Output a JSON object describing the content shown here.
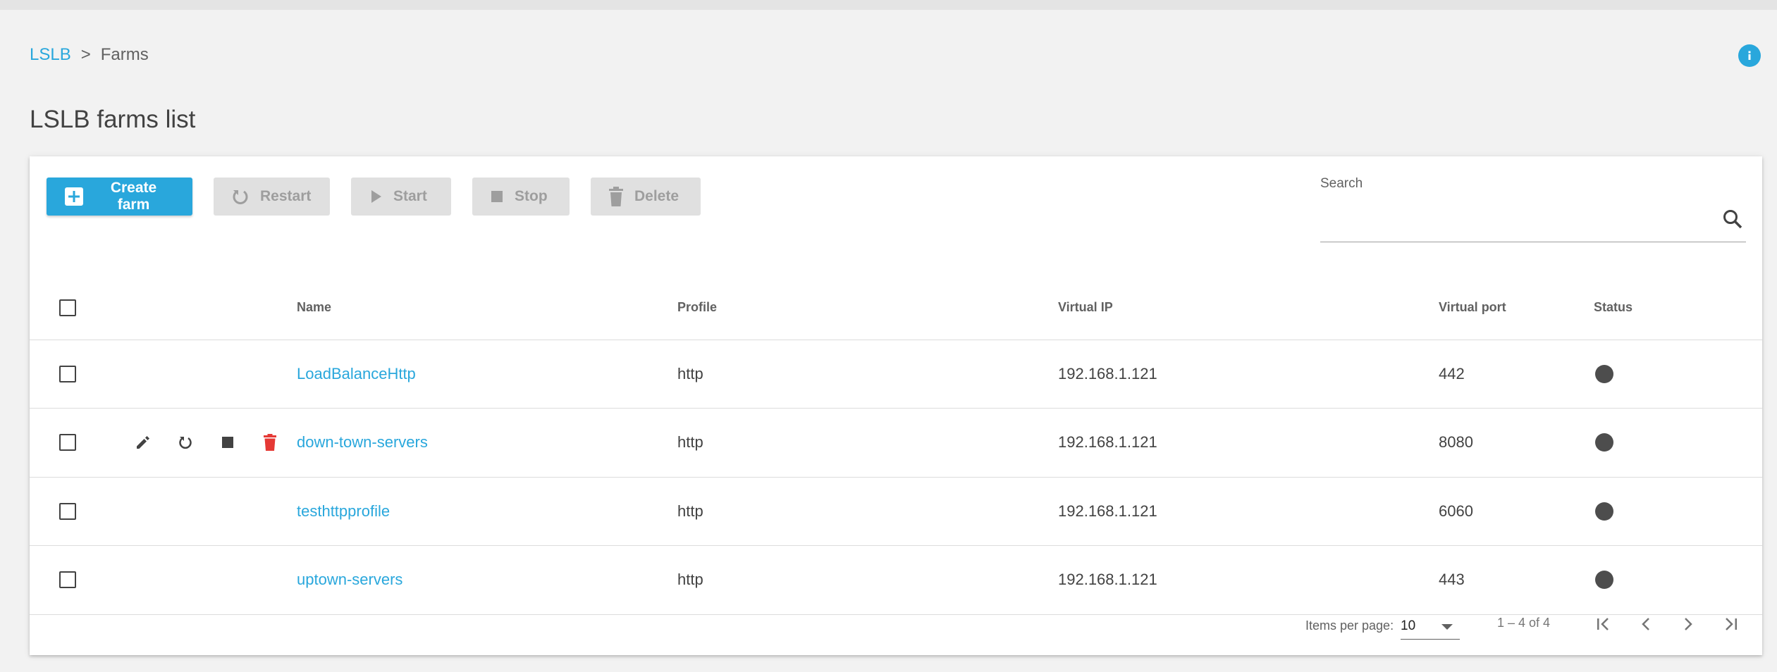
{
  "breadcrumb": {
    "root": "LSLB",
    "separator": ">",
    "current": "Farms"
  },
  "page": {
    "title": "LSLB farms list"
  },
  "toolbar": {
    "create_label": "Create farm",
    "restart_label": "Restart",
    "start_label": "Start",
    "stop_label": "Stop",
    "delete_label": "Delete"
  },
  "search": {
    "label": "Search",
    "value": ""
  },
  "table": {
    "columns": {
      "name": "Name",
      "profile": "Profile",
      "virtual_ip": "Virtual IP",
      "virtual_port": "Virtual port",
      "status": "Status"
    },
    "rows": [
      {
        "name": "LoadBalanceHttp",
        "profile": "http",
        "virtual_ip": "192.168.1.121",
        "virtual_port": "442",
        "status": "down"
      },
      {
        "name": "down-town-servers",
        "profile": "http",
        "virtual_ip": "192.168.1.121",
        "virtual_port": "8080",
        "status": "down"
      },
      {
        "name": "testhttpprofile",
        "profile": "http",
        "virtual_ip": "192.168.1.121",
        "virtual_port": "6060",
        "status": "down"
      },
      {
        "name": "uptown-servers",
        "profile": "http",
        "virtual_ip": "192.168.1.121",
        "virtual_port": "443",
        "status": "down"
      }
    ]
  },
  "paginator": {
    "items_per_page_label": "Items per page:",
    "page_size": "10",
    "range_label": "1 – 4 of 4"
  },
  "colors": {
    "accent": "#29a7dc",
    "delete": "#e53935",
    "status_down": "#4d4d4d",
    "disabled_bg": "#e0e0e0",
    "disabled_text": "#9e9e9e"
  },
  "icons": {
    "toolbar": [
      "add-box-icon",
      "restart-icon",
      "play-icon",
      "stop-icon",
      "trash-icon"
    ],
    "row_actions": [
      "edit-icon",
      "restart-icon",
      "stop-icon",
      "delete-icon"
    ],
    "pager": [
      "first-page-icon",
      "previous-page-icon",
      "next-page-icon",
      "last-page-icon"
    ]
  }
}
